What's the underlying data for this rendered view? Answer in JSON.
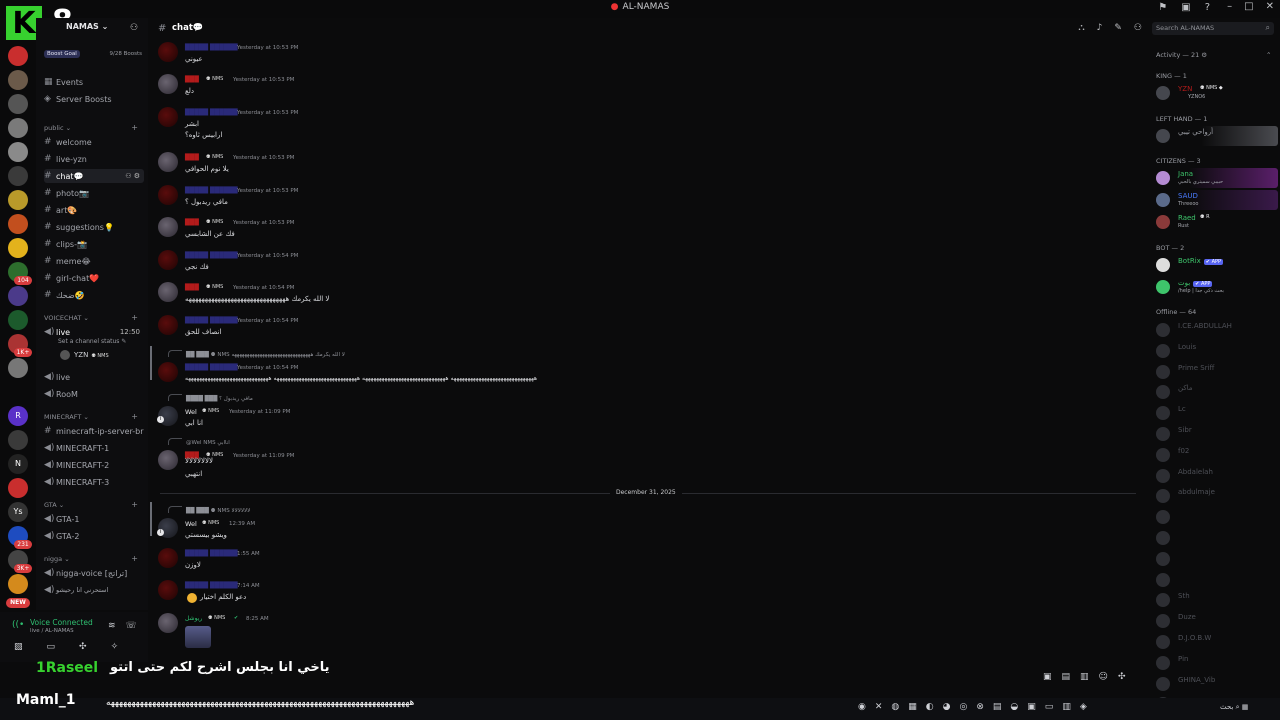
{
  "window": {
    "title": "AL-NAMAS"
  },
  "overlay": {
    "logo_letter": "K",
    "logo_digit": "8"
  },
  "server": {
    "name": "NAMAS",
    "boost_goal_label": "Boost Goal",
    "boost_count": "9/28 Boosts"
  },
  "sidebar": {
    "top": [
      {
        "label": "Events",
        "icon": "calendar-icon"
      },
      {
        "label": "Server Boosts",
        "icon": "boost-icon"
      }
    ],
    "categories": {
      "public": "public",
      "voicechat": "VOICECHAT",
      "minecraft": "MINECRAFT",
      "gta": "GTA",
      "nigga": "nigga"
    },
    "channels": [
      "welcome",
      "live-yzn",
      "chat💬",
      "photo📷",
      "art🎨",
      "suggestions💡",
      "clips-📸",
      "meme😂",
      "girl-chat❤️",
      "ضحك🤣"
    ],
    "voice_live": {
      "label": "live",
      "time": "12:50",
      "status": "Set a channel status",
      "user": "YZN",
      "user_tag": "NMS"
    },
    "voice_channels": [
      "live",
      "RooM"
    ],
    "minecraft_channels": [
      "minecraft-ip-server-br",
      "MINECRAFT-1",
      "MINECRAFT-2",
      "MINECRAFT-3"
    ],
    "gta_channels": [
      "GTA-1",
      "GTA-2"
    ],
    "nigga_channels": [
      "nigga-voice [تراتج]",
      "استحرني انا رحيشو"
    ]
  },
  "voice": {
    "connected": "Voice Connected",
    "location": "live / AL-NAMAS"
  },
  "header": {
    "channel": "chat💬",
    "search_placeholder": "Search AL-NAMAS"
  },
  "messages": [
    {
      "time": "Yesterday at 10:53 PM",
      "text": "عيوني"
    },
    {
      "tag": "NMS",
      "time": "Yesterday at 10:53 PM",
      "text": "دلع"
    },
    {
      "time": "Yesterday at 10:53 PM",
      "text": "ابشر",
      "text2": "ارابيس ثاوه؟"
    },
    {
      "tag": "NMS",
      "time": "Yesterday at 10:53 PM",
      "text": "يلا نوم الحوافي"
    },
    {
      "time": "Yesterday at 10:53 PM",
      "text": "مافي ريدبول ؟"
    },
    {
      "tag": "NMS",
      "time": "Yesterday at 10:53 PM",
      "text": "فك عن الشابسي"
    },
    {
      "time": "Yesterday at 10:54 PM",
      "text": "فك نجي"
    },
    {
      "tag": "NMS",
      "time": "Yesterday at 10:54 PM",
      "text": "لا الله يكرمك هههههههههههههههههههههههههههههههه"
    },
    {
      "time": "Yesterday at 10:54 PM",
      "text": "انصاف للحق"
    },
    {
      "reply": "لا الله يكرمك هههههههههههههههههههههههههههههههه",
      "time": "Yesterday at 10:54 PM",
      "text": "ههههههههههههههههههههههههههههههه ههههههههههههههههههههههههههههههه ههههههههههههههههههههههههههههههه ههههههههههههههههههههههههههههههه"
    },
    {
      "reply": "مافي ريدبول ؟",
      "user": "Wel",
      "tag": "NMS",
      "time": "Yesterday at 11:09 PM",
      "text": "انا ابي"
    },
    {
      "reply": "@Wel NMS اناابي",
      "tag": "NMS",
      "time": "Yesterday at 11:09 PM",
      "text": "لالالالالالالا",
      "text2": "انتهبي"
    },
    {
      "reply": "NMS لالالالالالا",
      "user": "Wel",
      "tag": "NMS",
      "time": "12:39 AM",
      "text": "ويشو بيسستي"
    },
    {
      "time": "1:55 AM",
      "text": "لاوزن"
    },
    {
      "time": "7:14 AM",
      "text": "دعو الكلم اختيار"
    },
    {
      "user": "ريوشل",
      "tag": "NMS",
      "time": "8:25 AM",
      "text": ""
    }
  ],
  "date_divider": "December 31, 2025",
  "members": {
    "activity": "Activity — 21",
    "king": {
      "header": "KING — 1",
      "name": "YZN",
      "tag": "NMS",
      "sub": "YZNO6"
    },
    "left_hand": {
      "header": "LEFT HAND — 1",
      "name": "أرواحي تيبي"
    },
    "citizens": {
      "header": "CITIZENS — 3",
      "list": [
        {
          "name": "Jana",
          "sub": "حبيبي سميتري بالحبي"
        },
        {
          "name": "SAUD",
          "sub": "Threeoo"
        },
        {
          "name": "Raed",
          "tag": "R",
          "sub": "Rust"
        }
      ]
    },
    "bot": {
      "header": "BOT — 2",
      "list": [
        {
          "name": "BotRix",
          "app": "APP",
          "sub": ""
        },
        {
          "name": "بوت",
          "app": "APP",
          "sub": "/help | بحث ذكي جدا"
        }
      ]
    },
    "offline": {
      "header": "Offline — 64",
      "list": [
        "I.CE.ABDULLAH",
        "Louis",
        "Prime Sriff",
        "ماكن",
        "Lc",
        "Sibr",
        "f02",
        "Abdalelah",
        "abdulmaje",
        "",
        "",
        "",
        "",
        "Sth",
        "Duze",
        "D.J.O.B.W",
        "Pin",
        "GHINA_Vib",
        ""
      ]
    }
  },
  "subtitle": {
    "arabic": "ياخي انا بجلس اشرح لكم حتى اتتو",
    "name": "1Raseel"
  },
  "overlay_chat": {
    "name": "Maml_1",
    "message": "هههههههههههههههههههههههههههههههههههههههههههههههههههههههههههههههههههههههههه"
  },
  "taskbar": {
    "lang": "بحث"
  }
}
